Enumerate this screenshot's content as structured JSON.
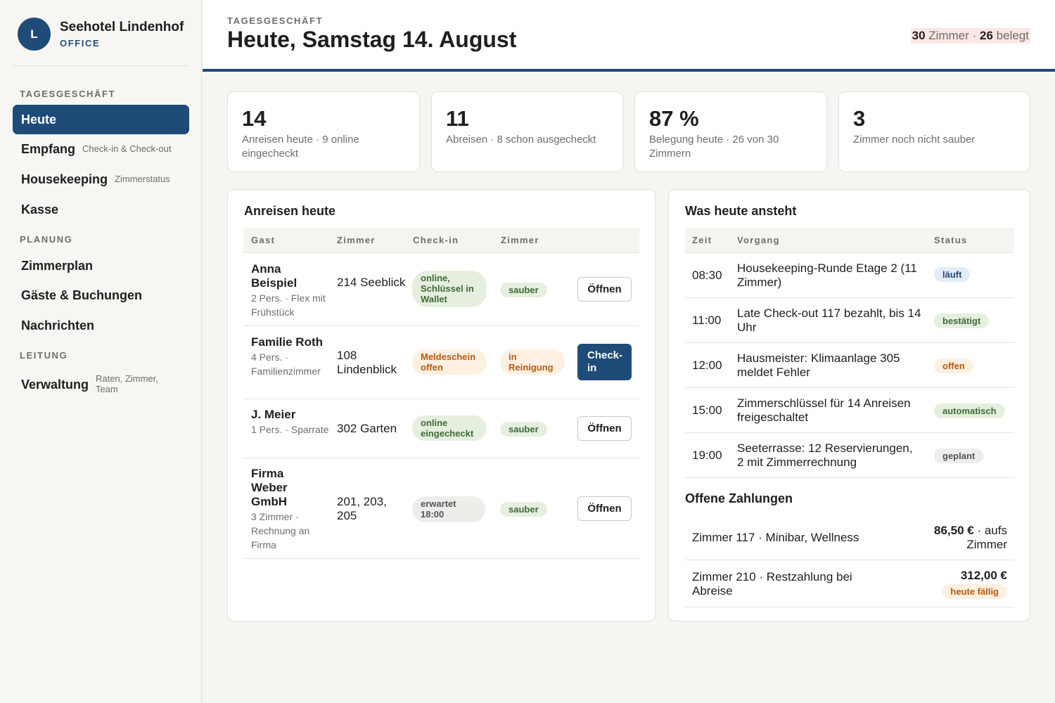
{
  "brand": {
    "initial": "L",
    "name": "Seehotel Lindenhof",
    "subtitle": "OFFICE"
  },
  "sidebar": {
    "sections": [
      {
        "label": "TAGESGESCHÄFT"
      },
      {
        "label": "PLANUNG"
      },
      {
        "label": "LEITUNG"
      }
    ],
    "items": [
      {
        "label": "Heute",
        "hint": ""
      },
      {
        "label": "Empfang",
        "hint": "Check-in & Check-out"
      },
      {
        "label": "Housekeeping",
        "hint": "Zimmerstatus"
      },
      {
        "label": "Kasse",
        "hint": ""
      },
      {
        "label": "Zimmerplan",
        "hint": ""
      },
      {
        "label": "Gäste & Buchungen",
        "hint": ""
      },
      {
        "label": "Nachrichten",
        "hint": ""
      },
      {
        "label": "Verwaltung",
        "hint": "Raten, Zimmer, Team"
      }
    ]
  },
  "header": {
    "eyebrow": "TAGESGESCHÄFT",
    "title": "Heute, Samstag 14. August",
    "rooms_total": "30",
    "rooms_label": "Zimmer ·",
    "rooms_occupied": "26",
    "occupied_label": "belegt"
  },
  "kpis": [
    {
      "value": "14",
      "label": "Anreisen heute · 9 online eingecheckt"
    },
    {
      "value": "11",
      "label": "Abreisen · 8 schon ausgecheckt"
    },
    {
      "value": "87 %",
      "label": "Belegung heute · 26 von 30 Zimmern"
    },
    {
      "value": "3",
      "label": "Zimmer noch nicht sauber"
    }
  ],
  "arrivals": {
    "title": "Anreisen heute",
    "columns": [
      "Gast",
      "Zimmer",
      "Check-in",
      "Zimmer"
    ],
    "rows": [
      {
        "name": "Anna Beispiel",
        "detail": "2 Pers. · Flex mit Frühstück",
        "room": "214 Seeblick",
        "checkin": "online, Schlüssel in Wallet",
        "room_status": "sauber",
        "action": "Öffnen"
      },
      {
        "name": "Familie Roth",
        "detail": "4 Pers. · Familienzimmer",
        "room": "108 Lindenblick",
        "checkin": "Meldeschein offen",
        "room_status": "in Reinigung",
        "action": "Check-in"
      },
      {
        "name": "J. Meier",
        "detail": "1 Pers. · Sparrate",
        "room": "302 Garten",
        "checkin": "online eingecheckt",
        "room_status": "sauber",
        "action": "Öffnen"
      },
      {
        "name": "Firma Weber GmbH",
        "detail": "3 Zimmer · Rechnung an Firma",
        "room": "201, 203, 205",
        "checkin": "erwartet 18:00",
        "room_status": "sauber",
        "action": "Öffnen"
      }
    ]
  },
  "agenda": {
    "title": "Was heute ansteht",
    "columns": [
      "Zeit",
      "Vorgang",
      "Status"
    ],
    "rows": [
      {
        "time": "08:30",
        "task": "Housekeeping-Runde Etage 2 (11 Zimmer)",
        "status": "läuft"
      },
      {
        "time": "11:00",
        "task": "Late Check-out 117 bezahlt, bis 14 Uhr",
        "status": "bestätigt"
      },
      {
        "time": "12:00",
        "task": "Hausmeister: Klimaanlage 305 meldet Fehler",
        "status": "offen"
      },
      {
        "time": "15:00",
        "task": "Zimmerschlüssel für 14 Anreisen freigeschaltet",
        "status": "automatisch"
      },
      {
        "time": "19:00",
        "task": "Seeterrasse: 12 Reservierungen, 2 mit Zimmerrechnung",
        "status": "geplant"
      }
    ]
  },
  "payments": {
    "title": "Offene Zahlungen",
    "rows": [
      {
        "desc": "Zimmer 117 · Minibar, Wellness",
        "amount": "86,50 €",
        "note": "· aufs Zimmer"
      },
      {
        "desc": "Zimmer 210 · Restzahlung bei Abreise",
        "amount": "312,00 €",
        "note": "heute fällig"
      }
    ]
  },
  "colors": {
    "accent": "#1f4b78",
    "pill_green": "#e6efdf",
    "pill_orange": "#fdf0e1",
    "pill_grey": "#eeedea",
    "pill_blue": "#e4ecf6",
    "occupancy_highlight": "#fbe6e6"
  }
}
